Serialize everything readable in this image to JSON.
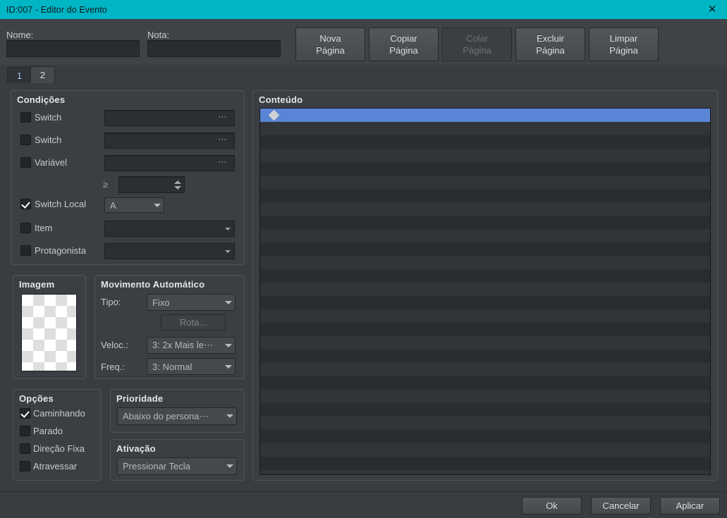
{
  "window": {
    "title": "ID:007 - Editor do Evento",
    "close_icon": "close-icon",
    "accent_color": "#00b5c4"
  },
  "form": {
    "name_label": "Nome:",
    "name_value": "",
    "note_label": "Nota:",
    "note_value": ""
  },
  "page_buttons": [
    {
      "line1": "Nova",
      "line2": "Página",
      "disabled": false
    },
    {
      "line1": "Copiar",
      "line2": "Página",
      "disabled": false
    },
    {
      "line1": "Colar",
      "line2": "Página",
      "disabled": true
    },
    {
      "line1": "Excluir",
      "line2": "Página",
      "disabled": false
    },
    {
      "line1": "Limpar",
      "line2": "Página",
      "disabled": false
    }
  ],
  "tabs": [
    {
      "label": "1",
      "active": false
    },
    {
      "label": "2",
      "active": true
    }
  ],
  "conditions": {
    "title": "Condições",
    "rows": [
      {
        "label": "Switch",
        "checked": false,
        "control": "pickfield",
        "value": ""
      },
      {
        "label": "Switch",
        "checked": false,
        "control": "pickfield",
        "value": ""
      },
      {
        "label": "Variável",
        "checked": false,
        "control": "pickfield",
        "value": ""
      },
      {
        "label": "Switch Local",
        "checked": true,
        "control": "combo",
        "value": "A"
      },
      {
        "label": "Item",
        "checked": false,
        "control": "darkcombo",
        "value": ""
      },
      {
        "label": "Protagonista",
        "checked": false,
        "control": "darkcombo",
        "value": ""
      }
    ],
    "comparator": "≥",
    "comparator_value": ""
  },
  "image": {
    "title": "Imagem",
    "preview": "checkerboard-transparent"
  },
  "auto_movement": {
    "title": "Movimento Automático",
    "type_label": "Tipo:",
    "type_value": "Fixo",
    "route_button": "Rota...",
    "route_disabled": true,
    "speed_label": "Veloc.:",
    "speed_value": "3: 2x Mais le⋯",
    "freq_label": "Freq.:",
    "freq_value": "3: Normal"
  },
  "options": {
    "title": "Opções",
    "items": [
      {
        "label": "Caminhando",
        "checked": true
      },
      {
        "label": "Parado",
        "checked": false
      },
      {
        "label": "Direção Fixa",
        "checked": false
      },
      {
        "label": "Atravessar",
        "checked": false
      }
    ]
  },
  "priority": {
    "title": "Prioridade",
    "value": "Abaixo do persona⋯"
  },
  "trigger": {
    "title": "Ativação",
    "value": "Pressionar Tecla"
  },
  "content": {
    "title": "Conteúdo",
    "rows": [
      {
        "selected": true,
        "marker": "diamond",
        "text": ""
      }
    ],
    "total_rows": 28,
    "selection_color": "#5a85d6"
  },
  "footer": {
    "ok": "Ok",
    "cancel": "Cancelar",
    "apply": "Aplicar"
  }
}
